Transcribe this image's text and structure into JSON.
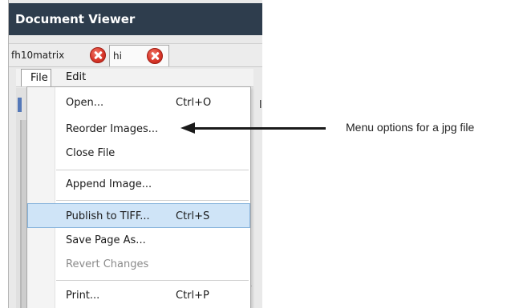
{
  "window": {
    "title": "Document Viewer"
  },
  "tabs": [
    {
      "label": "fh10matrix"
    },
    {
      "label": "hi"
    }
  ],
  "menubar": {
    "file_label": "File",
    "edit_label": "Edit"
  },
  "file_menu": {
    "items": [
      {
        "label": "Open...",
        "shortcut": "Ctrl+O",
        "enabled": true
      },
      {
        "label": "Reorder Images...",
        "shortcut": "",
        "enabled": true
      },
      {
        "label": "Close File",
        "shortcut": "",
        "enabled": true
      },
      {
        "label": "Append Image...",
        "shortcut": "",
        "enabled": true
      },
      {
        "label": "Publish to TIFF...",
        "shortcut": "Ctrl+S",
        "enabled": true,
        "highlighted": true
      },
      {
        "label": "Save Page As...",
        "shortcut": "",
        "enabled": true
      },
      {
        "label": "Revert Changes",
        "shortcut": "",
        "enabled": false
      },
      {
        "label": "Print...",
        "shortcut": "Ctrl+P",
        "enabled": true
      }
    ]
  },
  "annotation": {
    "text": "Menu options for a jpg file"
  },
  "colors": {
    "titlebar": "#2e3d4d",
    "highlight": "#cfe4f7",
    "close_button": "#d9372a"
  }
}
